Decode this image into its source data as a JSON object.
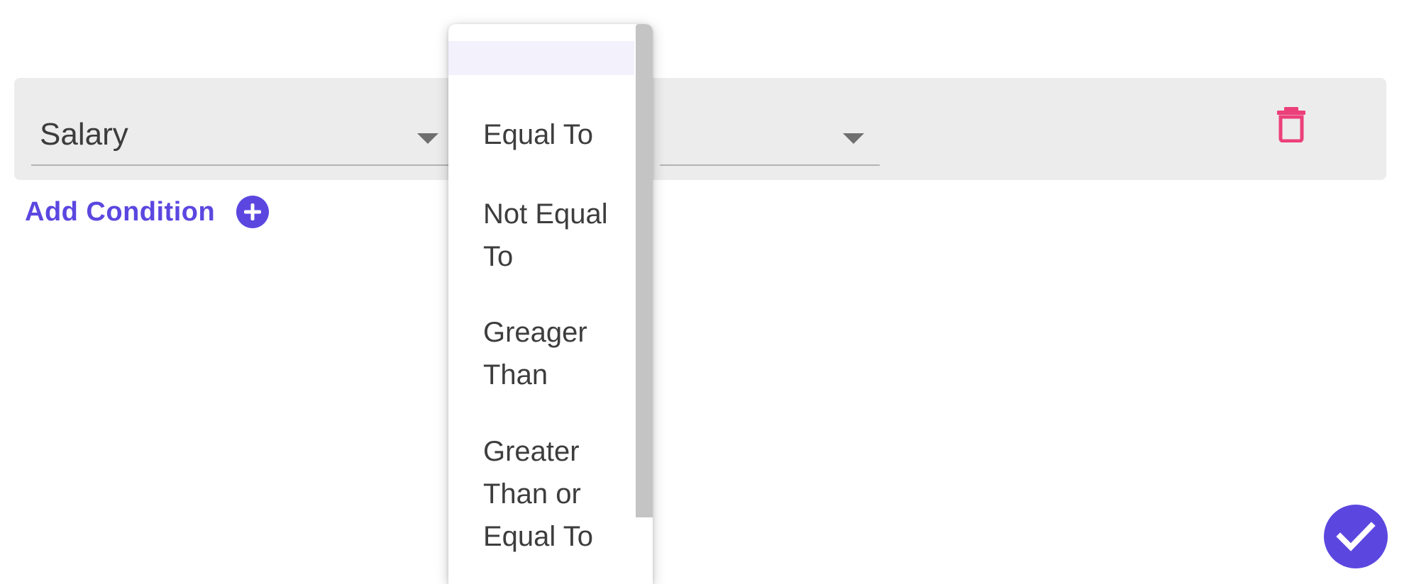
{
  "condition": {
    "field_value": "Salary",
    "operator_value": ""
  },
  "add_condition": {
    "label": "Add Condition"
  },
  "dropdown": {
    "options": [
      "",
      "Equal To",
      "Not Equal To",
      "Greager Than",
      "Greater Than or Equal To"
    ],
    "highlighted_index": 0
  },
  "icons": {
    "delete": "trash-icon",
    "add": "plus-circle-icon",
    "confirm": "check-icon",
    "caret": "caret-down-icon"
  },
  "colors": {
    "accent": "#5b47e0",
    "delete": "#ec407a",
    "row_background": "#ececec",
    "highlight": "#f2f1fc"
  }
}
